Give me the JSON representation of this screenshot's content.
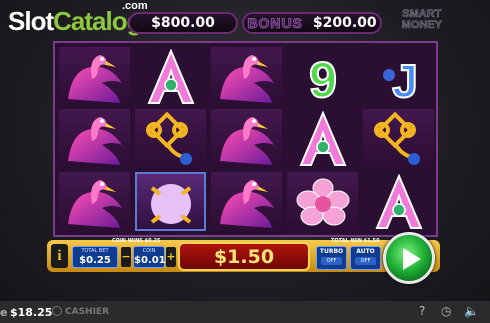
{
  "watermark": {
    "part1": "Slot",
    "part2": "Catalog",
    "domain": ".com"
  },
  "top": {
    "balance_display": "$800.00",
    "bonus_label": "BONUS",
    "bonus_value": "$200.00",
    "logo_line1": "SMART",
    "logo_line2": "MONEY"
  },
  "reels": {
    "symbols": [
      [
        "flamingo",
        "flamingo",
        "flamingo"
      ],
      [
        "A",
        "knot-charm",
        "pearl"
      ],
      [
        "flamingo",
        "flamingo",
        "flamingo"
      ],
      [
        "9",
        "A",
        "peony"
      ],
      [
        "J",
        "knot-charm",
        "A"
      ]
    ],
    "letters": {
      "A": "A",
      "nine": "9",
      "J": "J"
    }
  },
  "controls": {
    "info": "i",
    "coins_label": "COIN WINS $0.25",
    "total_bet_label": "TOTAL BET",
    "total_bet_value": "$0.25",
    "coin_label": "COIN",
    "coin_value": "$0.01",
    "minus": "−",
    "plus": "+",
    "win_value": "$1.50",
    "total_win_label": "TOTAL WIN  $1.50",
    "turbo_label": "TURBO",
    "turbo_state": "OFF",
    "auto_label": "AUTO",
    "auto_state": "OFF"
  },
  "statusbar": {
    "balance_prefix": "e",
    "balance": "$18.25",
    "cashier": "CASHIER"
  },
  "colors": {
    "accent": "#8dc63f",
    "reel_bg": "#2a0f33",
    "spin": "#23b33a",
    "gold": "#f1c232"
  }
}
